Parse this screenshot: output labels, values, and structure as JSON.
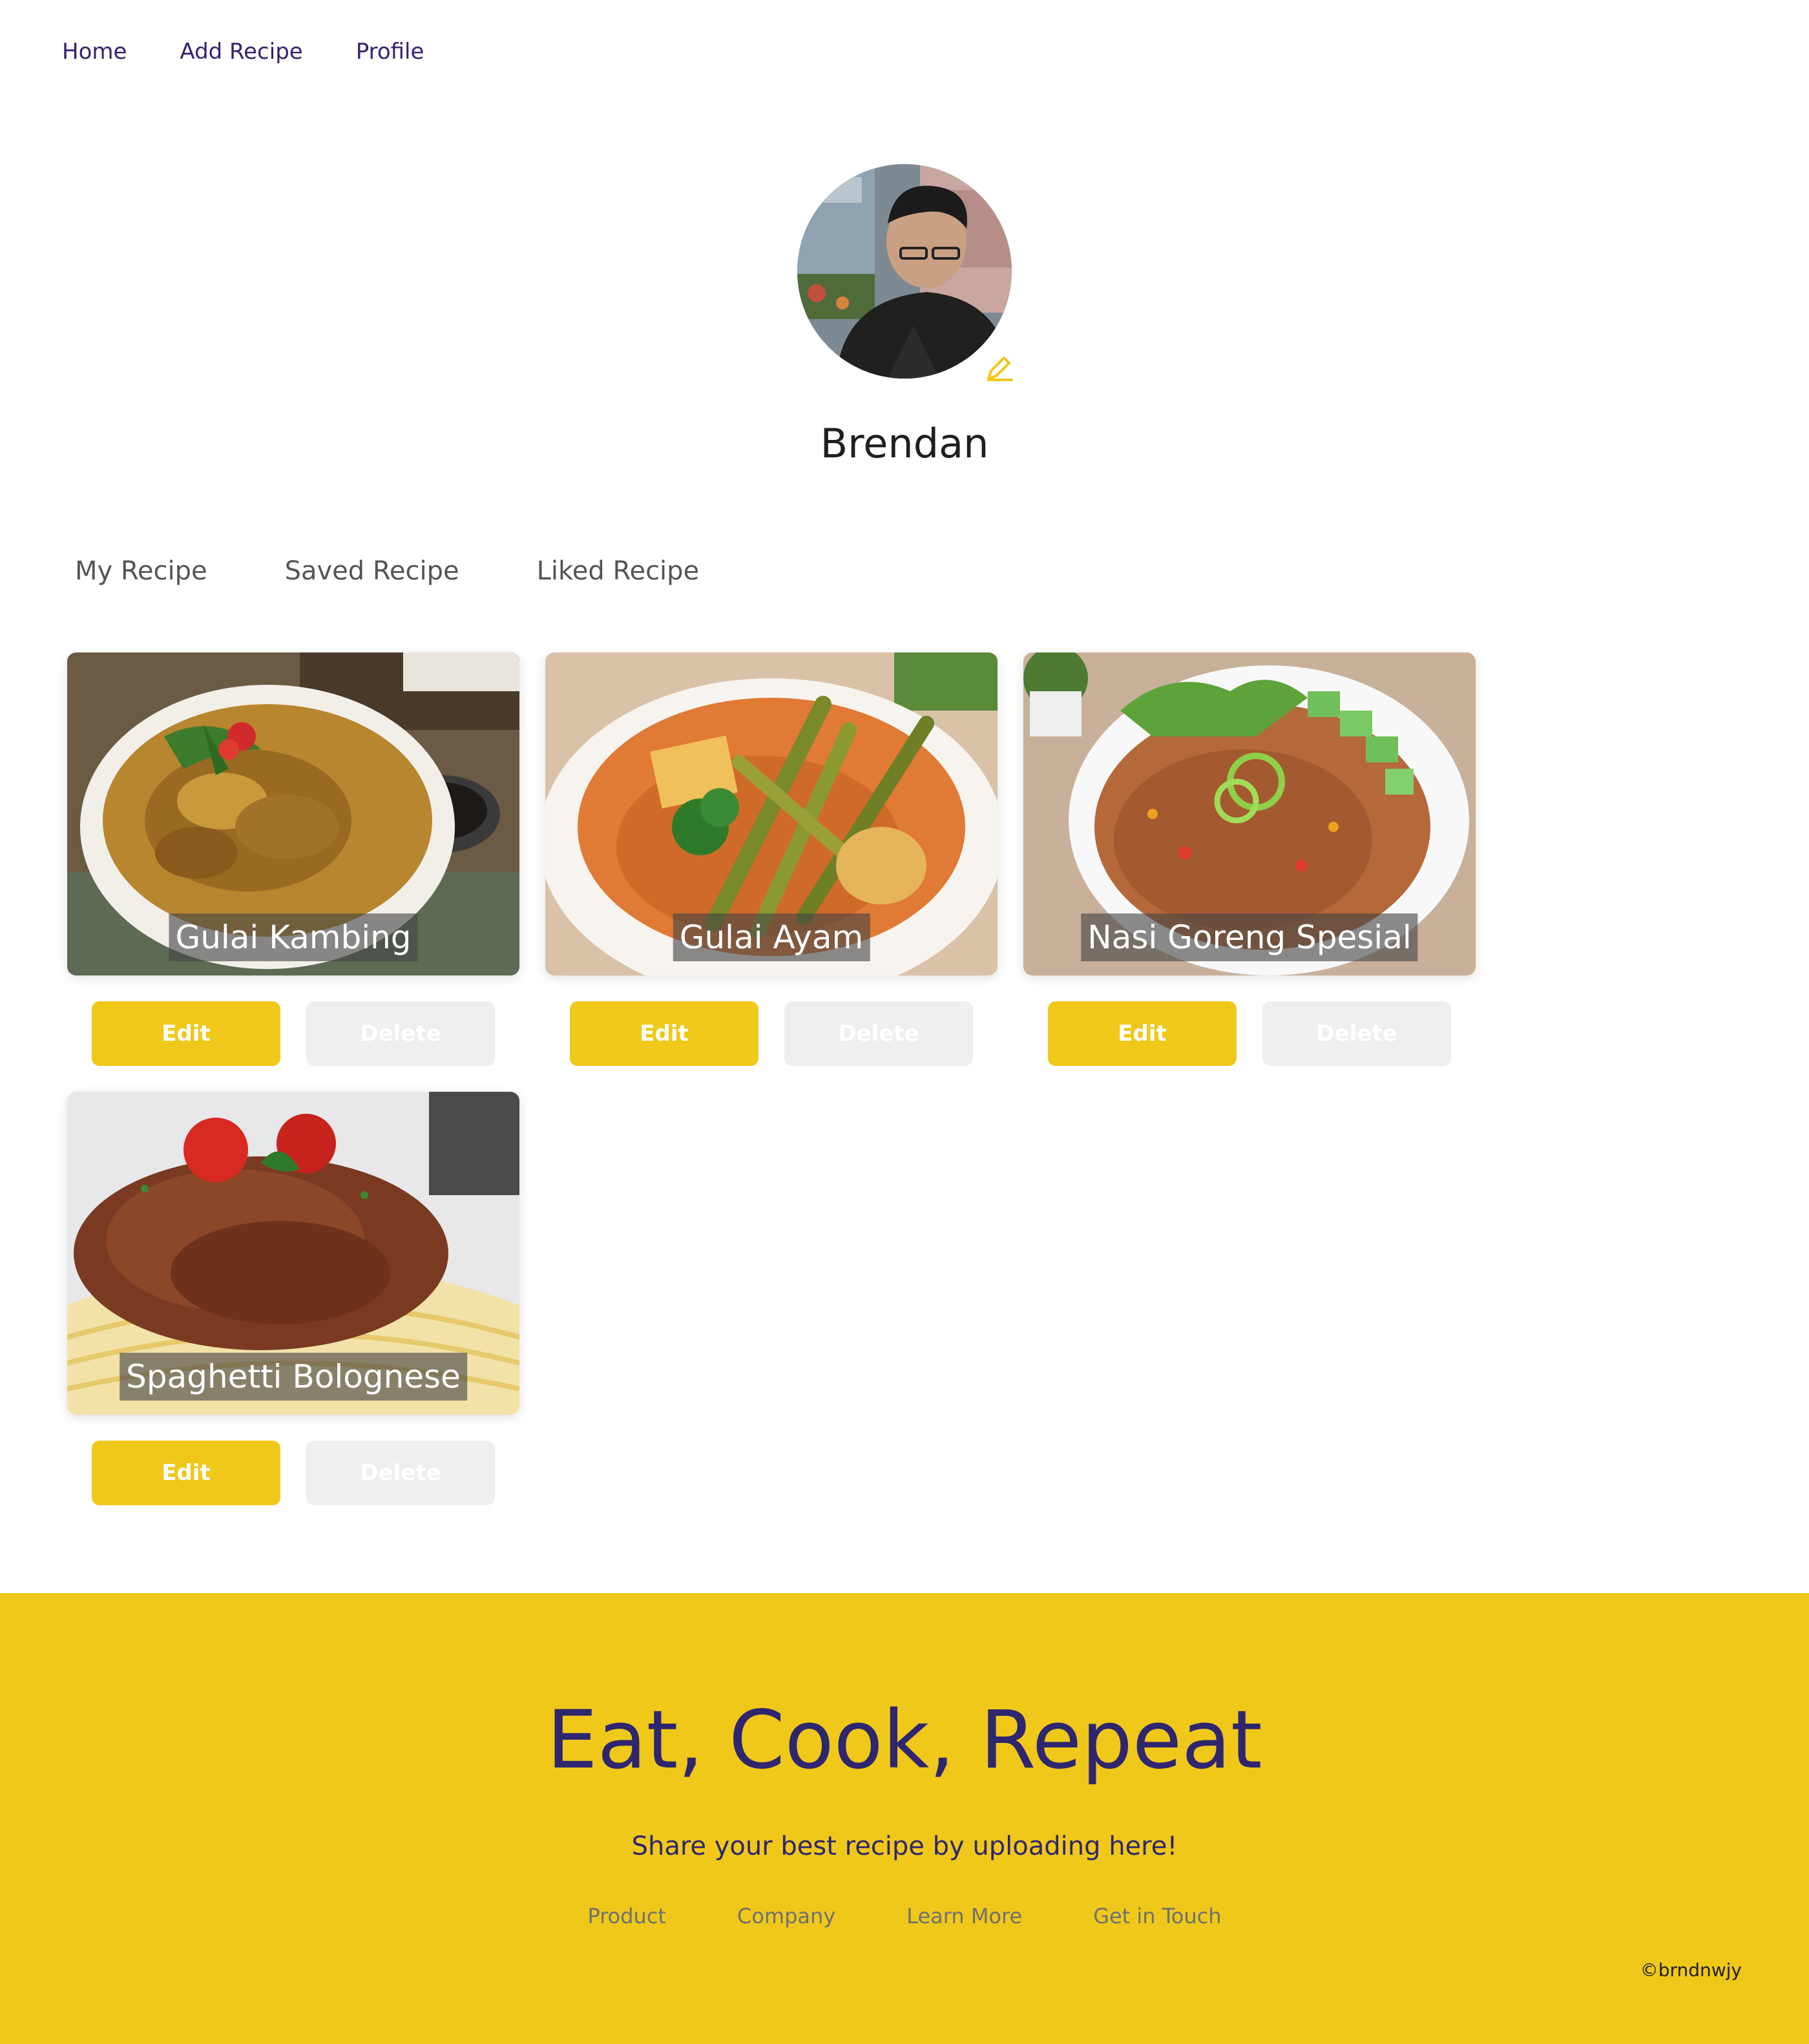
{
  "nav": {
    "home": "Home",
    "add_recipe": "Add Recipe",
    "profile": "Profile"
  },
  "profile": {
    "username": "Brendan",
    "edit_icon": "pencil-icon"
  },
  "tabs": [
    "My Recipe",
    "Saved Recipe",
    "Liked Recipe"
  ],
  "recipes": [
    {
      "title": "Gulai Kambing",
      "edit_label": "Edit",
      "delete_label": "Delete"
    },
    {
      "title": "Gulai Ayam",
      "edit_label": "Edit",
      "delete_label": "Delete"
    },
    {
      "title": "Nasi Goreng Spesial",
      "edit_label": "Edit",
      "delete_label": "Delete"
    },
    {
      "title": "Spaghetti Bolognese",
      "edit_label": "Edit",
      "delete_label": "Delete"
    }
  ],
  "footer": {
    "title": "Eat, Cook, Repeat",
    "subtitle": "Share your best recipe by uploading here!",
    "links": [
      "Product",
      "Company",
      "Learn More",
      "Get in Touch"
    ],
    "copyright": "©brndnwjy"
  },
  "colors": {
    "primary": "#EFC81A",
    "accent": "#2E266F",
    "delete_button": "#EFEFEF"
  }
}
